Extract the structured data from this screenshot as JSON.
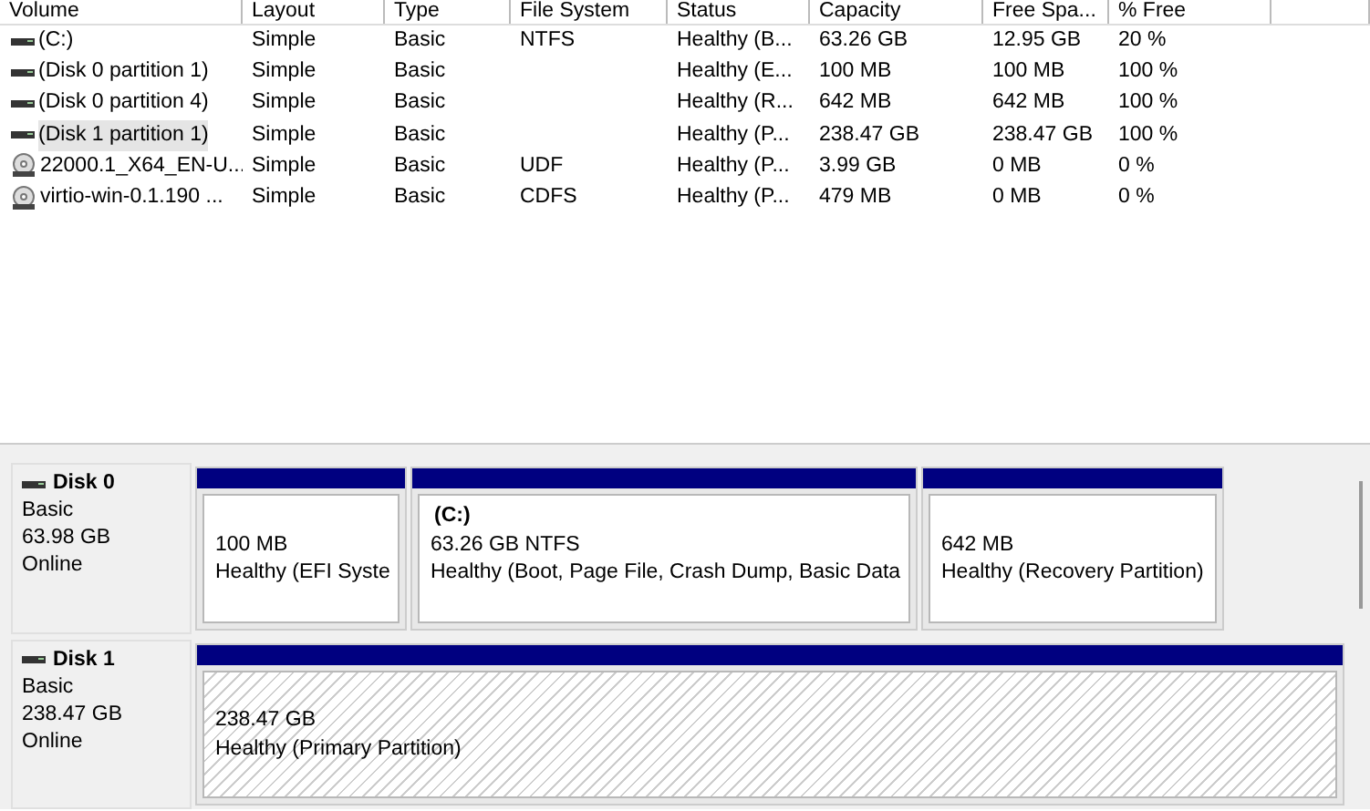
{
  "table": {
    "columns": [
      "Volume",
      "Layout",
      "Type",
      "File System",
      "Status",
      "Capacity",
      "Free Spa...",
      "% Free"
    ],
    "rows": [
      {
        "kind": "hdd",
        "selected": false,
        "cells": [
          " (C:)",
          "Simple",
          "Basic",
          "NTFS",
          "Healthy (B...",
          "63.26 GB",
          "12.95 GB",
          "20 %"
        ]
      },
      {
        "kind": "hdd",
        "selected": false,
        "cells": [
          "(Disk 0 partition 1)",
          "Simple",
          "Basic",
          "",
          "Healthy (E...",
          "100 MB",
          "100 MB",
          "100 %"
        ]
      },
      {
        "kind": "hdd",
        "selected": false,
        "cells": [
          "(Disk 0 partition 4)",
          "Simple",
          "Basic",
          "",
          "Healthy (R...",
          "642 MB",
          "642 MB",
          "100 %"
        ]
      },
      {
        "kind": "hdd",
        "selected": true,
        "cells": [
          "(Disk 1 partition 1)",
          "Simple",
          "Basic",
          "",
          "Healthy (P...",
          "238.47 GB",
          "238.47 GB",
          "100 %"
        ]
      },
      {
        "kind": "disc",
        "selected": false,
        "cells": [
          "22000.1_X64_EN-U...",
          "Simple",
          "Basic",
          "UDF",
          "Healthy (P...",
          "3.99 GB",
          "0 MB",
          "0 %"
        ]
      },
      {
        "kind": "disc",
        "selected": false,
        "cells": [
          "virtio-win-0.1.190 ...",
          "Simple",
          "Basic",
          "CDFS",
          "Healthy (P...",
          "479 MB",
          "0 MB",
          "0 %"
        ]
      }
    ]
  },
  "disks": [
    {
      "name": "Disk 0",
      "type": "Basic",
      "size": "63.98 GB",
      "state": "Online",
      "partitions": [
        {
          "selected": false,
          "size": "100 MB",
          "status": "Healthy (EFI Syste"
        },
        {
          "selected": false,
          "name": "(C:)",
          "size": "63.26 GB NTFS",
          "status": "Healthy (Boot, Page File, Crash Dump, Basic Data"
        },
        {
          "selected": false,
          "size": "642 MB",
          "status": "Healthy (Recovery Partition)"
        }
      ]
    },
    {
      "name": "Disk 1",
      "type": "Basic",
      "size": "238.47 GB",
      "state": "Online",
      "partitions": [
        {
          "selected": true,
          "size": "238.47 GB",
          "status": "Healthy (Primary Partition)"
        }
      ]
    }
  ]
}
